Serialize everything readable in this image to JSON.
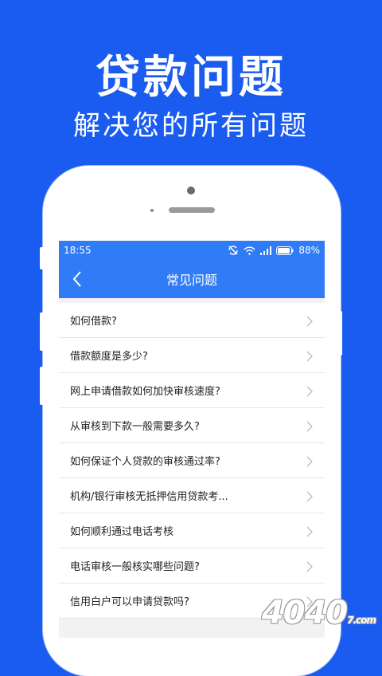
{
  "headline": "贷款问题",
  "subline": "解决您的所有问题",
  "status_bar": {
    "time": "18:55",
    "battery": "88%",
    "icons": [
      "sync-off-icon",
      "wifi-icon",
      "signal-icon",
      "battery-icon"
    ]
  },
  "nav": {
    "back_icon": "chevron-left-icon",
    "title": "常见问题"
  },
  "faq": [
    "如何借款?",
    "借款额度是多少?",
    "网上申请借款如何加快审核速度?",
    "从审核到下款一般需要多久?",
    "如何保证个人贷款的审核通过率?",
    "机构/银行审核无抵押信用贷款考...",
    "如何顺利通过电话考核",
    "电话审核一般核实哪些问题?",
    "信用白户可以申请贷款吗?"
  ],
  "watermark": {
    "text": "4040",
    "suffix": "7.com"
  },
  "colors": {
    "background": "#1a5cf0",
    "app_bar": "#2f7cf6"
  }
}
